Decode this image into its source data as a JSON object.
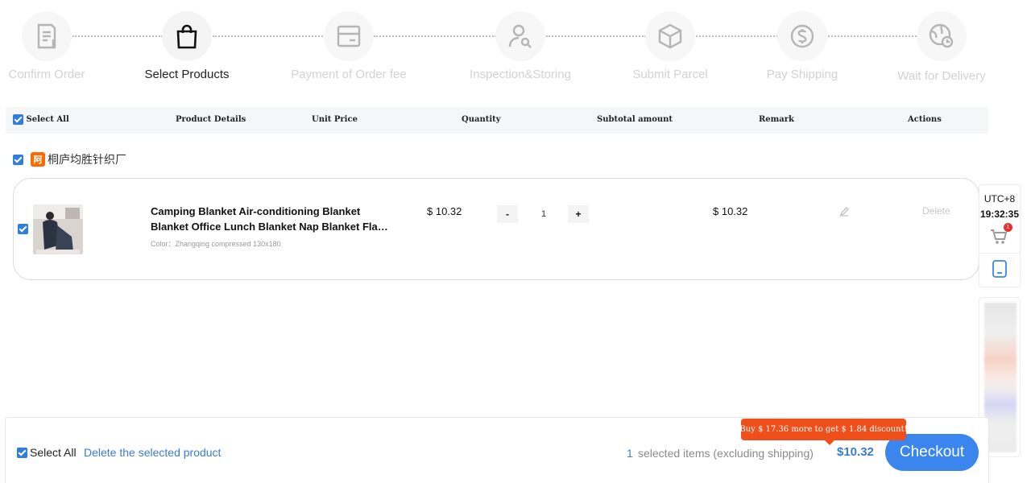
{
  "steps": [
    {
      "label": "Confirm Order",
      "icon": "document-icon",
      "active": false
    },
    {
      "label": "Select Products",
      "icon": "shopping-bag-icon",
      "active": true
    },
    {
      "label": "Payment of Order fee",
      "icon": "card-icon",
      "active": false
    },
    {
      "label": "Inspection&Storing",
      "icon": "user-search-icon",
      "active": false
    },
    {
      "label": "Submit Parcel",
      "icon": "box-icon",
      "active": false
    },
    {
      "label": "Pay Shipping",
      "icon": "dollar-icon",
      "active": false
    },
    {
      "label": "Wait for Delivery",
      "icon": "globe-clock-icon",
      "active": false
    }
  ],
  "table_header": {
    "select_all": "Select All",
    "product_details": "Product Details",
    "unit_price": "Unit Price",
    "quantity": "Quantity",
    "subtotal": "Subtotal amount",
    "remark": "Remark",
    "actions": "Actions"
  },
  "store": {
    "name": "桐庐均胜针织厂",
    "logo_icon": "alibaba-logo-icon",
    "logo_color": "#ff6a00"
  },
  "product": {
    "title_line1": "Camping Blanket Air-conditioning Blanket",
    "title_line2": "Blanket Office Lunch Blanket Nap Blanket Flan…",
    "variant": "Color：Zhangqing compressed 130x180",
    "unit_price": "$ 10.32",
    "quantity": "1",
    "minus": "-",
    "plus": "+",
    "subtotal": "$ 10.32",
    "delete_label": "Delete",
    "checked": true
  },
  "side_widget": {
    "timezone": "UTC+8",
    "time": "19:32:35",
    "cart_badge": "1"
  },
  "bottom_bar": {
    "select_all": "Select All",
    "delete_selected": "Delete the selected product",
    "selected_count": "1",
    "selected_text": "selected items (excluding shipping)",
    "total": "$10.32",
    "checkout": "Checkout",
    "discount_tip": "Buy $ 17.36 more to get $ 1.84 discount!"
  },
  "colors": {
    "accent": "#3b86ee",
    "link": "#3a7bd5",
    "tooltip": "#ef4f1a",
    "checkbox": "#2f7de1"
  }
}
